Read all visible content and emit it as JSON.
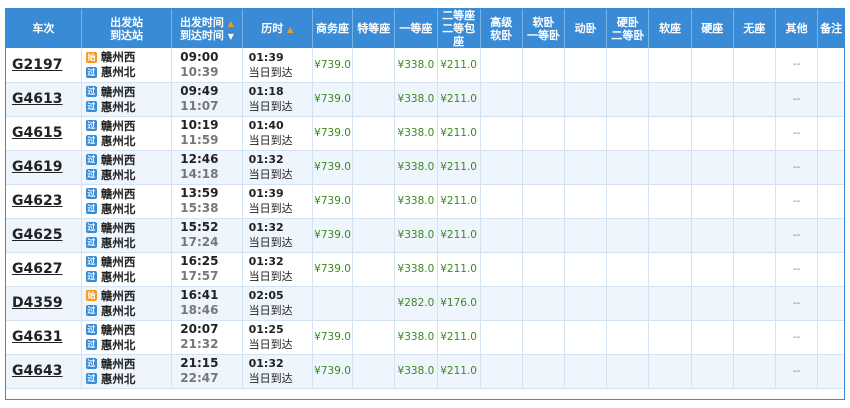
{
  "header": {
    "train": "车次",
    "station_line1": "出发站",
    "station_line2": "到达站",
    "time_line1": "出发时间",
    "time_line2": "到达时间",
    "duration": "历时",
    "business": "商务座",
    "premium": "特等座",
    "first": "一等座",
    "second_line1": "二等座",
    "second_line2": "二等包座",
    "hsoft_line1": "高级",
    "hsoft_line2": "软卧",
    "softsleeper_line1": "软卧",
    "softsleeper_line2": "一等卧",
    "dongwo": "动卧",
    "hardsleeper_line1": "硬卧",
    "hardsleeper_line2": "二等卧",
    "softseat": "软座",
    "hardseat": "硬座",
    "noseat": "无座",
    "other": "其他",
    "remark": "备注"
  },
  "badges": {
    "start": "始",
    "pass": "过"
  },
  "rows": [
    {
      "train": "G2197",
      "from": "赣州西",
      "to": "惠州北",
      "from_type": "start",
      "dep": "09:00",
      "arr": "10:39",
      "dur": "01:39",
      "arrive_note": "当日到达",
      "business": "¥739.0",
      "first": "¥338.0",
      "second": "¥211.0",
      "other": "--"
    },
    {
      "train": "G4613",
      "from": "赣州西",
      "to": "惠州北",
      "from_type": "pass",
      "dep": "09:49",
      "arr": "11:07",
      "dur": "01:18",
      "arrive_note": "当日到达",
      "business": "¥739.0",
      "first": "¥338.0",
      "second": "¥211.0",
      "other": "--"
    },
    {
      "train": "G4615",
      "from": "赣州西",
      "to": "惠州北",
      "from_type": "pass",
      "dep": "10:19",
      "arr": "11:59",
      "dur": "01:40",
      "arrive_note": "当日到达",
      "business": "¥739.0",
      "first": "¥338.0",
      "second": "¥211.0",
      "other": "--"
    },
    {
      "train": "G4619",
      "from": "赣州西",
      "to": "惠州北",
      "from_type": "pass",
      "dep": "12:46",
      "arr": "14:18",
      "dur": "01:32",
      "arrive_note": "当日到达",
      "business": "¥739.0",
      "first": "¥338.0",
      "second": "¥211.0",
      "other": "--"
    },
    {
      "train": "G4623",
      "from": "赣州西",
      "to": "惠州北",
      "from_type": "pass",
      "dep": "13:59",
      "arr": "15:38",
      "dur": "01:39",
      "arrive_note": "当日到达",
      "business": "¥739.0",
      "first": "¥338.0",
      "second": "¥211.0",
      "other": "--"
    },
    {
      "train": "G4625",
      "from": "赣州西",
      "to": "惠州北",
      "from_type": "pass",
      "dep": "15:52",
      "arr": "17:24",
      "dur": "01:32",
      "arrive_note": "当日到达",
      "business": "¥739.0",
      "first": "¥338.0",
      "second": "¥211.0",
      "other": "--"
    },
    {
      "train": "G4627",
      "from": "赣州西",
      "to": "惠州北",
      "from_type": "pass",
      "dep": "16:25",
      "arr": "17:57",
      "dur": "01:32",
      "arrive_note": "当日到达",
      "business": "¥739.0",
      "first": "¥338.0",
      "second": "¥211.0",
      "other": "--"
    },
    {
      "train": "D4359",
      "from": "赣州西",
      "to": "惠州北",
      "from_type": "start",
      "dep": "16:41",
      "arr": "18:46",
      "dur": "02:05",
      "arrive_note": "当日到达",
      "business": "",
      "first": "¥282.0",
      "second": "¥176.0",
      "other": "--"
    },
    {
      "train": "G4631",
      "from": "赣州西",
      "to": "惠州北",
      "from_type": "pass",
      "dep": "20:07",
      "arr": "21:32",
      "dur": "01:25",
      "arrive_note": "当日到达",
      "business": "¥739.0",
      "first": "¥338.0",
      "second": "¥211.0",
      "other": "--"
    },
    {
      "train": "G4643",
      "from": "赣州西",
      "to": "惠州北",
      "from_type": "pass",
      "dep": "21:15",
      "arr": "22:47",
      "dur": "01:32",
      "arrive_note": "当日到达",
      "business": "¥739.0",
      "first": "¥338.0",
      "second": "¥211.0",
      "other": "--"
    }
  ]
}
